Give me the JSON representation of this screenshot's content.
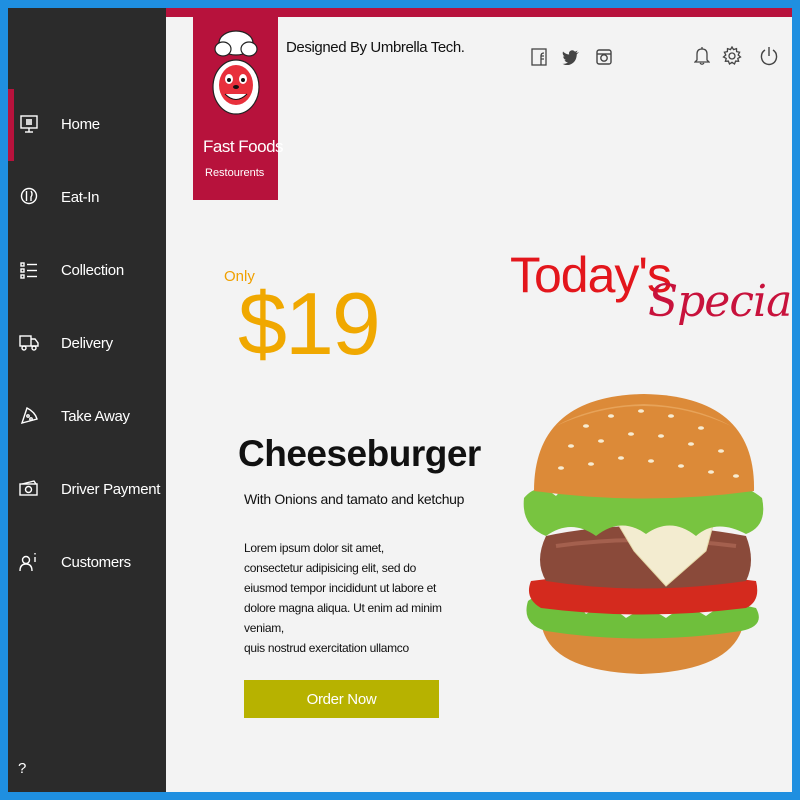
{
  "header": {
    "designed_by": "Designed By Umbrella Tech."
  },
  "logo": {
    "title": "Fast Foods",
    "subtitle": "Restourents"
  },
  "sidebar": {
    "items": [
      {
        "label": "Home",
        "icon": "monitor-icon",
        "active": true
      },
      {
        "label": "Eat-In",
        "icon": "eat-in-icon",
        "active": false
      },
      {
        "label": "Collection",
        "icon": "list-icon",
        "active": false
      },
      {
        "label": "Delivery",
        "icon": "truck-icon",
        "active": false
      },
      {
        "label": "Take Away",
        "icon": "pizza-slice-icon",
        "active": false
      },
      {
        "label": "Driver Payment",
        "icon": "cash-icon",
        "active": false
      },
      {
        "label": "Customers",
        "icon": "customer-icon",
        "active": false
      }
    ],
    "help": "?"
  },
  "social_icons": [
    "facebook-icon",
    "twitter-icon",
    "instagram-icon"
  ],
  "utility_icons": [
    "bell-icon",
    "gear-icon",
    "power-icon"
  ],
  "special": {
    "only": "Only",
    "price": "$19",
    "name": "Cheeseburger",
    "subtitle": "With Onions and tamato and ketchup",
    "description": "Lorem ipsum dolor sit amet,\n consectetur adipisicing elit, sed do\n eiusmod tempor incididunt ut labore et\ndolore magna aliqua. Ut enim ad minim veniam,\nquis nostrud exercitation ullamco",
    "order_label": "Order Now",
    "todays": "Today's",
    "special_word": "Special"
  },
  "colors": {
    "accent": "#b7123c",
    "sidebar": "#2b2b2b",
    "price": "#f0a800",
    "button": "#b7b200",
    "todays": "#e3161c",
    "frame": "#1f8fe0"
  }
}
